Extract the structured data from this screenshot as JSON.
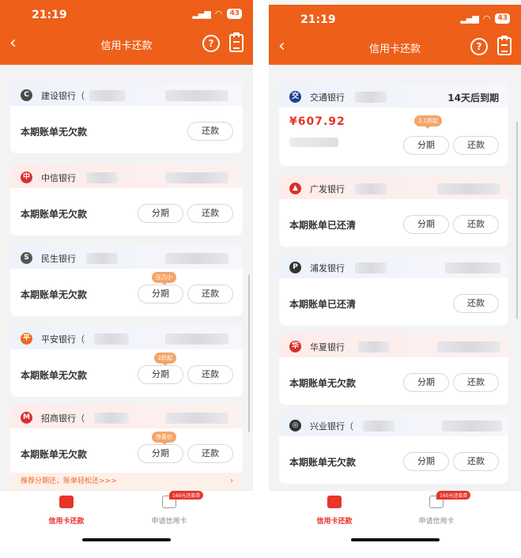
{
  "status": {
    "time": "21:19",
    "battery": "43"
  },
  "nav": {
    "title": "信用卡还款",
    "back": "‹",
    "help": "?"
  },
  "buttons": {
    "pay": "还款",
    "split": "分期"
  },
  "left": {
    "cards": [
      {
        "bank": "建设银行",
        "bank_suffix": "（",
        "icon_color": "#4a4a4a",
        "status": "本期账单无欠款",
        "has_split": false
      },
      {
        "bank": "中信银行",
        "icon_color": "#d9302c",
        "status": "本期账单无欠款",
        "has_split": true
      },
      {
        "bank": "民生银行",
        "icon_color": "#555555",
        "status": "本期账单无欠款",
        "has_split": true,
        "promo": "压力小"
      },
      {
        "bank": "平安银行",
        "bank_suffix": "（",
        "icon_color": "#ee6a1d",
        "status": "本期账单无欠款",
        "has_split": true,
        "promo": "2折起"
      },
      {
        "bank": "招商银行",
        "bank_suffix": "（",
        "icon_color": "#d9302c",
        "status": "本期账单无欠款",
        "has_split": true,
        "promo": "惊喜价"
      }
    ],
    "tip": "推荐分期还，账单轻松还>>>",
    "tip_chevron": "›"
  },
  "right": {
    "cards": [
      {
        "bank": "交通银行",
        "icon_color": "#1d3f8f",
        "due": "14天后到期",
        "amount": "¥607.92",
        "has_split": true,
        "promo": "3.1折起"
      },
      {
        "bank": "广发银行",
        "icon_color": "#d9302c",
        "status": "本期账单已还清",
        "has_split": true
      },
      {
        "bank": "浦发银行",
        "icon_color": "#333333",
        "status": "本期账单已还清",
        "has_split": false
      },
      {
        "bank": "华夏银行",
        "icon_color": "#d9302c",
        "status": "本期账单无欠款",
        "has_split": true
      },
      {
        "bank": "兴业银行",
        "bank_suffix": "（",
        "icon_color": "#333333",
        "status": "本期账单无欠款",
        "has_split": true
      }
    ]
  },
  "tabs": [
    {
      "label": "信用卡还款",
      "active": true
    },
    {
      "label": "申请信用卡",
      "active": false,
      "badge": "160元还款券"
    }
  ],
  "colors": {
    "brand": "#ee5f19",
    "accent": "#e8342a"
  }
}
